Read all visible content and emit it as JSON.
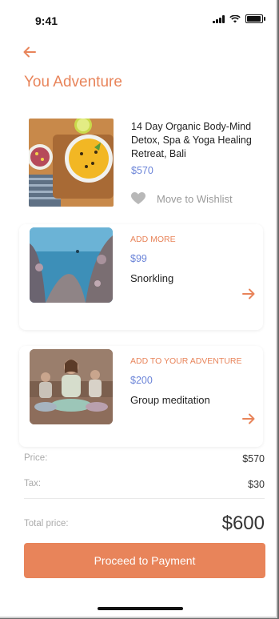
{
  "status": {
    "time": "9:41"
  },
  "header": {
    "title": "You Adventure"
  },
  "trip": {
    "title": "14 Day Organic Body-Mind Detox, Spa & Yoga Healing Retreat, Bali",
    "price": "$570",
    "wishlist_label": "Move to Wishlist",
    "image_icon": "food-bowls-image"
  },
  "addons": [
    {
      "tag": "ADD MORE",
      "price": "$99",
      "name": "Snorkling",
      "image_icon": "underwater-reef-image"
    },
    {
      "tag": "ADD TO YOUR ADVENTURE",
      "price": "$200",
      "name": "Group meditation",
      "image_icon": "meditation-group-image"
    }
  ],
  "summary": {
    "price_label": "Price:",
    "price_value": "$570",
    "tax_label": "Tax:",
    "tax_value": "$30",
    "total_label": "Total price:",
    "total_value": "$600"
  },
  "cta": {
    "label": "Proceed to Payment"
  },
  "colors": {
    "accent": "#e8845a",
    "price_blue": "#6b84d8"
  }
}
